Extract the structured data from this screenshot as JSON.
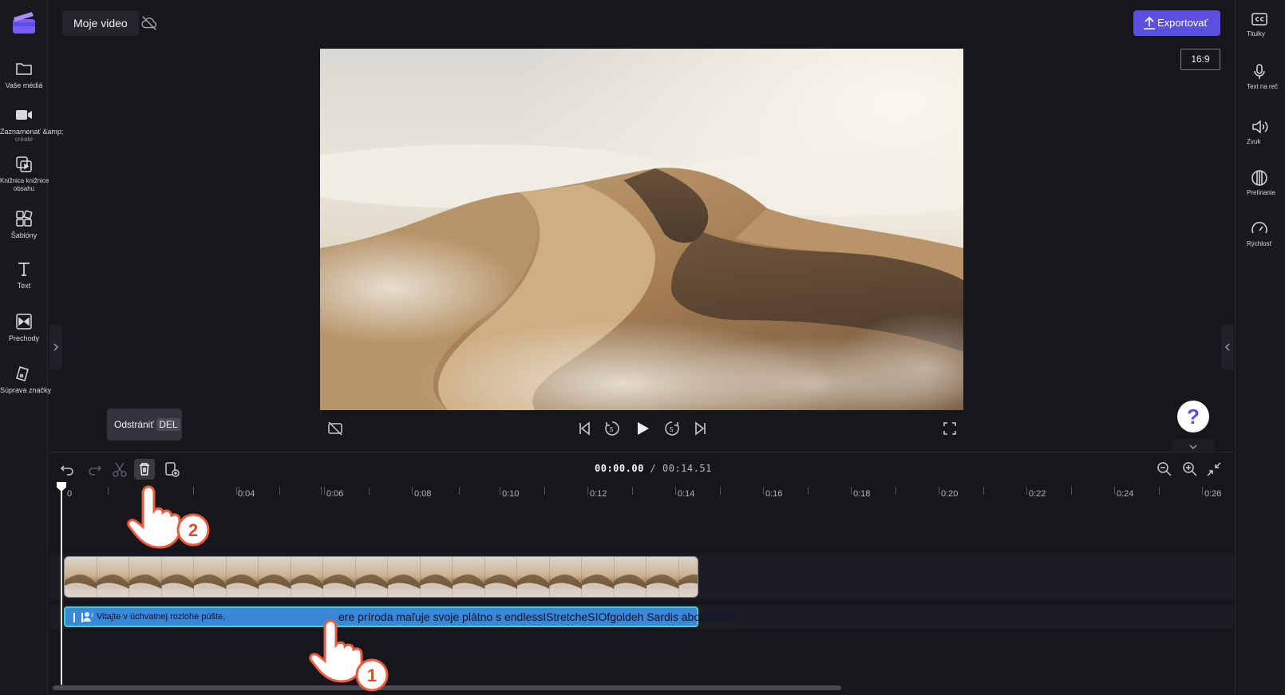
{
  "colors": {
    "accent": "#5b4fe0",
    "caption_clip": "#3a87d6",
    "caption_border": "#4ec6d9",
    "background": "#16161c"
  },
  "left_nav": [
    {
      "label": "Vaše médiá",
      "sublabel": "",
      "icon": "folder-icon"
    },
    {
      "label": "Zaznamenať &amp;",
      "sublabel": "create",
      "icon": "video-camera-icon"
    },
    {
      "label": "Knižnica knižnice",
      "sublabel": "obsahu",
      "icon": "content-library-icon"
    },
    {
      "label": "Šablóny",
      "sublabel": "",
      "icon": "templates-icon"
    },
    {
      "label": "Text",
      "sublabel": "",
      "icon": "text-icon"
    },
    {
      "label": "Prechody",
      "sublabel": "",
      "icon": "transitions-icon"
    },
    {
      "label": "Súprava značky",
      "sublabel": "",
      "icon": "brand-kit-icon"
    }
  ],
  "header": {
    "project_title": "Moje video",
    "cloud_status_icon": "cloud-off-icon",
    "export_label": "Exportovať",
    "aspect_ratio": "16:9"
  },
  "right_nav": [
    {
      "label": "Titulky",
      "icon": "captions-icon"
    },
    {
      "label": "Text na reč",
      "icon": "text-to-speech-icon"
    },
    {
      "label": "Zvuk",
      "icon": "speaker-icon"
    },
    {
      "label": "Prelínanie",
      "icon": "fade-icon"
    },
    {
      "label": "Rýchlosť",
      "icon": "speed-icon"
    }
  ],
  "player": {
    "help_label": "?"
  },
  "timeline": {
    "current_time": "00:00.00",
    "separator": "/",
    "total_time": "00:14.51",
    "tooltip_label": "Odstrániť",
    "tooltip_key": "DEL",
    "ruler_labels": [
      "0",
      "0:04",
      "0:06",
      "0:08",
      "0:10",
      "0:12",
      "0:14",
      "0:16",
      "0:18",
      "0:20",
      "0:22",
      "0:24",
      "0:26"
    ],
    "caption_start": "Vitajte v úchvatnej rozlohe púšte,",
    "caption_rest": "ere príroda maľuje svoje plátno s endlessIStretcheSIOfgoldeh Sardis aboüiidiéSI",
    "callout_1": "1",
    "callout_2": "2"
  }
}
